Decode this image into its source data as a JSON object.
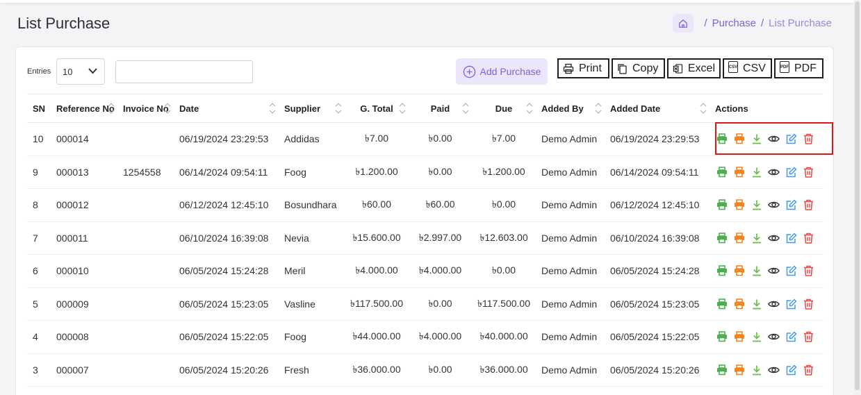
{
  "page": {
    "title": "List Purchase"
  },
  "breadcrumb": {
    "items": [
      "Purchase",
      "List Purchase"
    ]
  },
  "toolbar": {
    "entries_label": "Entries",
    "entries_value": "10",
    "search_placeholder": "",
    "add_label": "Add Purchase",
    "print_label": "Print",
    "copy_label": "Copy",
    "excel_label": "Excel",
    "csv_label": "CSV",
    "pdf_label": "PDF",
    "csv_icon": "CSV",
    "pdf_icon": "PDF"
  },
  "table": {
    "headers": {
      "sn": "SN",
      "reference": "Reference No",
      "invoice": "Invoice No",
      "date": "Date",
      "supplier": "Supplier",
      "gtotal": "G. Total",
      "paid": "Paid",
      "due": "Due",
      "added_by": "Added By",
      "added_date": "Added Date",
      "actions": "Actions"
    },
    "rows": [
      {
        "sn": "10",
        "ref": "000014",
        "inv": "",
        "date": "06/19/2024",
        "time": "23:29:53",
        "supplier": "Addidas",
        "gtotal": "৳7.00",
        "paid": "৳0.00",
        "due": "৳7.00",
        "added_by": "Demo Admin",
        "added_date": "06/19/2024",
        "added_time": "23:29:53"
      },
      {
        "sn": "9",
        "ref": "000013",
        "inv": "1254558",
        "date": "06/14/2024",
        "time": "09:54:11",
        "supplier": "Foog",
        "gtotal": "৳1.200.00",
        "paid": "৳0.00",
        "due": "৳1.200.00",
        "added_by": "Demo Admin",
        "added_date": "06/14/2024",
        "added_time": "09:54:11"
      },
      {
        "sn": "8",
        "ref": "000012",
        "inv": "",
        "date": "06/12/2024",
        "time": "12:45:10",
        "supplier": "Bosundhara",
        "gtotal": "৳60.00",
        "paid": "৳60.00",
        "due": "৳0.00",
        "added_by": "Demo Admin",
        "added_date": "06/12/2024",
        "added_time": "12:45:10"
      },
      {
        "sn": "7",
        "ref": "000011",
        "inv": "",
        "date": "06/10/2024",
        "time": "16:39:08",
        "supplier": "Nevia",
        "gtotal": "৳15.600.00",
        "paid": "৳2.997.00",
        "due": "৳12.603.00",
        "added_by": "Demo Admin",
        "added_date": "06/10/2024",
        "added_time": "16:39:08"
      },
      {
        "sn": "6",
        "ref": "000010",
        "inv": "",
        "date": "06/05/2024",
        "time": "15:24:28",
        "supplier": "Meril",
        "gtotal": "৳4.000.00",
        "paid": "৳4.000.00",
        "due": "৳0.00",
        "added_by": "Demo Admin",
        "added_date": "06/05/2024",
        "added_time": "15:24:28"
      },
      {
        "sn": "5",
        "ref": "000009",
        "inv": "",
        "date": "06/05/2024",
        "time": "15:23:05",
        "supplier": "Vasline",
        "gtotal": "৳117.500.00",
        "paid": "৳0.00",
        "due": "৳117.500.00",
        "added_by": "Demo Admin",
        "added_date": "06/05/2024",
        "added_time": "15:23:05"
      },
      {
        "sn": "4",
        "ref": "000008",
        "inv": "",
        "date": "06/05/2024",
        "time": "15:22:05",
        "supplier": "Foog",
        "gtotal": "৳44.000.00",
        "paid": "৳4.000.00",
        "due": "৳40.000.00",
        "added_by": "Demo Admin",
        "added_date": "06/05/2024",
        "added_time": "15:22:05"
      },
      {
        "sn": "3",
        "ref": "000007",
        "inv": "",
        "date": "06/05/2024",
        "time": "15:20:26",
        "supplier": "Fresh",
        "gtotal": "৳36.000.00",
        "paid": "৳0.00",
        "due": "৳36.000.00",
        "added_by": "Demo Admin",
        "added_date": "06/05/2024",
        "added_time": "15:20:26"
      }
    ]
  },
  "colors": {
    "accent": "#7c62d6",
    "accent_bg": "#ece6fb",
    "print_green": "#4caf50",
    "print_orange": "#f5851f",
    "download_green": "#6cc04a",
    "view": "#333333",
    "edit_blue": "#3f9ae8",
    "delete_red": "#ef4444",
    "highlight_red": "#e0151a"
  },
  "icons": {
    "home": "home-icon",
    "add": "plus-circle-icon",
    "print": "printer-icon",
    "copy": "copy-icon",
    "excel": "excel-icon",
    "csv": "csv-icon",
    "pdf": "pdf-icon",
    "sort": "sort-icon",
    "row_actions": [
      "print-icon",
      "print-icon",
      "download-icon",
      "eye-icon",
      "edit-icon",
      "trash-icon"
    ]
  }
}
